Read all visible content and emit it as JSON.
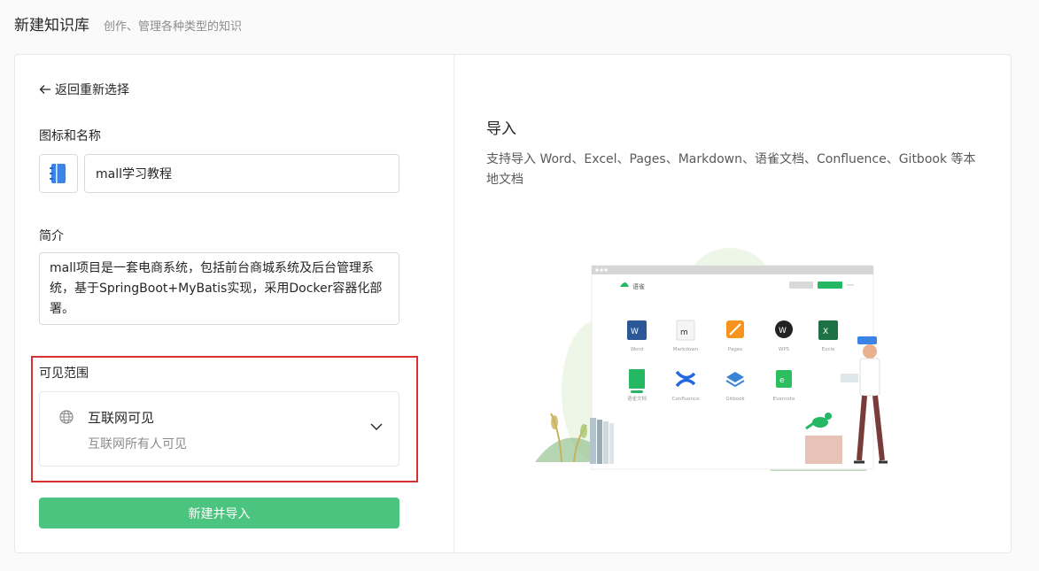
{
  "header": {
    "title": "新建知识库",
    "subtitle": "创作、管理各种类型的知识"
  },
  "form": {
    "back_label": "返回重新选择",
    "icon_name_label": "图标和名称",
    "book_icon": "notebook-icon",
    "name_value": "mall学习教程",
    "intro_label": "简介",
    "intro_value": "mall项目是一套电商系统，包括前台商城系统及后台管理系统，基于SpringBoot+MyBatis实现，采用Docker容器化部署。",
    "visibility_label": "可见范围",
    "visibility": {
      "icon": "globe-icon",
      "title": "互联网可见",
      "description": "互联网所有人可见"
    },
    "submit_label": "新建并导入"
  },
  "import": {
    "title": "导入",
    "description": "支持导入 Word、Excel、Pages、Markdown、语雀文档、Confluence、Gitbook 等本地文档",
    "illustration": {
      "brand": "语雀",
      "apps": [
        {
          "label": "Word",
          "color": "#2b5797"
        },
        {
          "label": "Markdown",
          "color": "#333333"
        },
        {
          "label": "Pages",
          "color": "#f7941e"
        },
        {
          "label": "WPS",
          "color": "#222222"
        },
        {
          "label": "Excle",
          "color": "#1e7145"
        },
        {
          "label": "语雀文档",
          "color": "#25b864"
        },
        {
          "label": "Confluence",
          "color": "#2468e0"
        },
        {
          "label": "Gitbook",
          "color": "#3a84d6"
        },
        {
          "label": "Evernote",
          "color": "#2dbe60"
        }
      ]
    }
  },
  "colors": {
    "accent_green": "#4ac47e",
    "highlight_red": "#d9312f"
  }
}
